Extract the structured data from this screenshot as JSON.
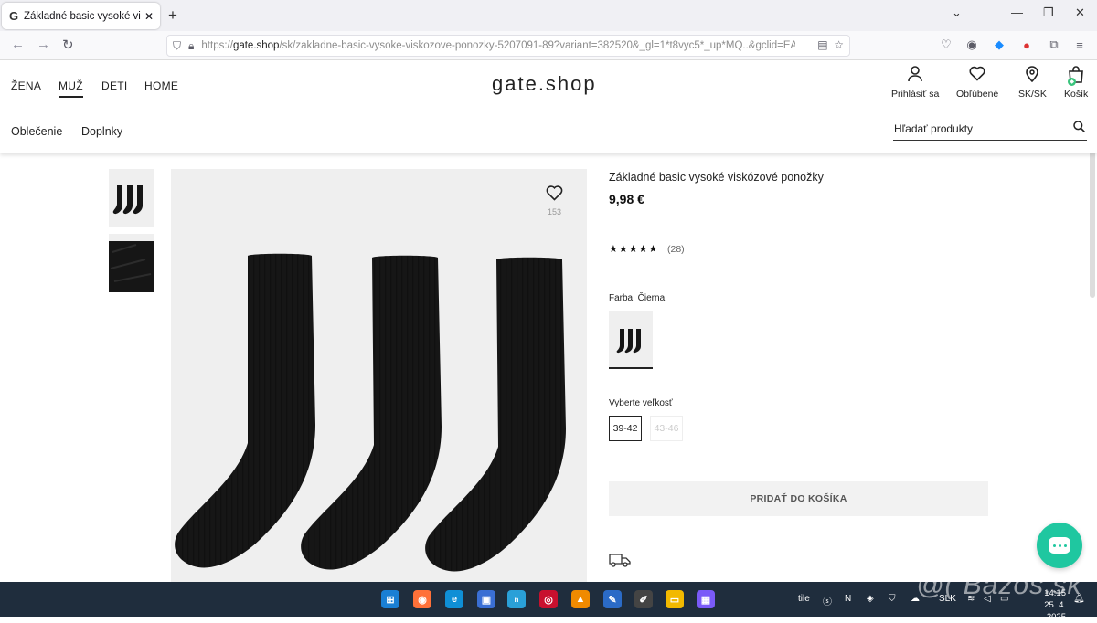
{
  "browser": {
    "tab_title": "Základné basic vysoké viskózov",
    "tab_favicon": "G",
    "url_prefix": "https://",
    "url_host": "gate.shop",
    "url_path": "/sk/zakladne-basic-vysoke-viskozove-ponozky-5207091-89?variant=382520&_gl=1*t8vyc5*_up*MQ..&gclid=EAIaIQobC"
  },
  "header": {
    "nav": [
      "ŽENA",
      "MUŽ",
      "DETI",
      "HOME"
    ],
    "active_nav": "MUŽ",
    "logo": "gate.shop",
    "icons": {
      "login": "Prihlásiť sa",
      "favorites": "Obľúbené",
      "region": "SK/SK",
      "cart": "Košík"
    },
    "subnav": [
      "Oblečenie",
      "Doplnky"
    ],
    "search_placeholder": "Hľadať produkty"
  },
  "product": {
    "title": "Základné basic vysoké viskózové ponožky",
    "price": "9,98 €",
    "rating_stars": "★★★★★",
    "rating_count": "(28)",
    "wishlist_count": "153",
    "color_label": "Farba: Čierna",
    "size_label": "Vyberte veľkosť",
    "sizes": [
      "39-42",
      "43-46"
    ],
    "add_to_cart": "PRIDAŤ DO KOŠÍKA"
  },
  "taskbar": {
    "tray_text": "tile",
    "language": "SLK",
    "time": "14:15",
    "date": "25. 4. 2025",
    "watermark": "@( Bazos.sk"
  },
  "colors": {
    "chat_button": "#1fc7a0",
    "taskbar": "#1f2d3d",
    "sock": "#161616"
  }
}
